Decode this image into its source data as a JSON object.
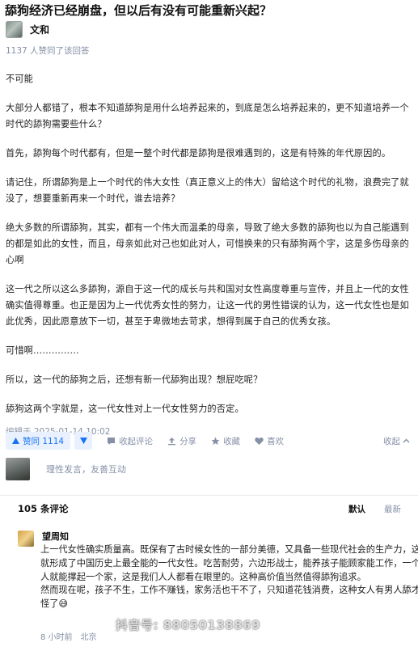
{
  "question": {
    "title": "舔狗经济已经崩盘，但以后有没有可能重新兴起？"
  },
  "author": {
    "name": "文和"
  },
  "agree_note": "1137 人赞同了该回答",
  "answer": {
    "paragraphs": [
      "不可能",
      "大部分人都错了，根本不知道舔狗是用什么培养起来的，到底是怎么培养起来的，更不知道培养一个时代的舔狗需要些什么？",
      "首先，舔狗每个时代都有，但是一整个时代都是舔狗是很难遇到的，这是有特殊的年代原因的。",
      "请记住，所谓舔狗是上一个时代的伟大女性（真正意义上的伟大）留给这个时代的礼物，浪费完了就没了，想要重新再来一个时代，谁去培养？",
      "绝大多数的所谓舔狗，其实，都有一个伟大而温柔的母亲，导致了绝大多数的舔狗也以为自己能遇到的都是如此的女性，而且，母亲如此对己也如此对人，可惜换来的只有舔狗两个字，这是多伤母亲的心啊",
      "这一代之所以这么多舔狗，源自于这一代的成长与共和国对女性高度尊重与宣传，并且上一代的女性确实值得尊重。也正是因为上一代优秀女性的努力，让这一代的男性错误的认为，这一代女性也是如此优秀，因此愿意放下一切，甚至于卑微地去苛求，想得到属于自己的优秀女孩。",
      "可惜啊……………",
      "所以，这一代的舔狗之后，还想有新一代舔狗出现？想屁吃呢？",
      "舔狗这两个字就是，这一代女性对上一代女性努力的否定。"
    ],
    "edited": "编辑于 2025-01-14 10:02"
  },
  "actions": {
    "vote_label": "赞同 1114",
    "collect_comment": "收起评论",
    "share": "分享",
    "favorite": "收藏",
    "like": "喜欢",
    "collapse": "收起"
  },
  "comment_input": {
    "placeholder": "理性发言，友善互动"
  },
  "comments_header": {
    "count_label": "105 条评论",
    "sort_default": "默认",
    "sort_newest": "最新"
  },
  "comment": {
    "author": "望周知",
    "lines": [
      "上一代女性确实质量高。既保有了古时候女性的一部分美德，又具备一些现代社会的生产力，这就形成了中国历史上最全能的一代女性。吃苦耐劳，六边形战士，能养孩子能顾家能工作，一个人就能撑起一个家，这是我们人人都看在眼里的。这种高价值当然值得舔狗追求。",
      "然而现在呢，孩子不生，工作不赚钱，家务活也干不了，只知道花钱消费，这种女人有男人舔才怪了😅"
    ],
    "time": "8 小时前",
    "location": "北京"
  },
  "watermark": "抖音号: 88050138869"
}
